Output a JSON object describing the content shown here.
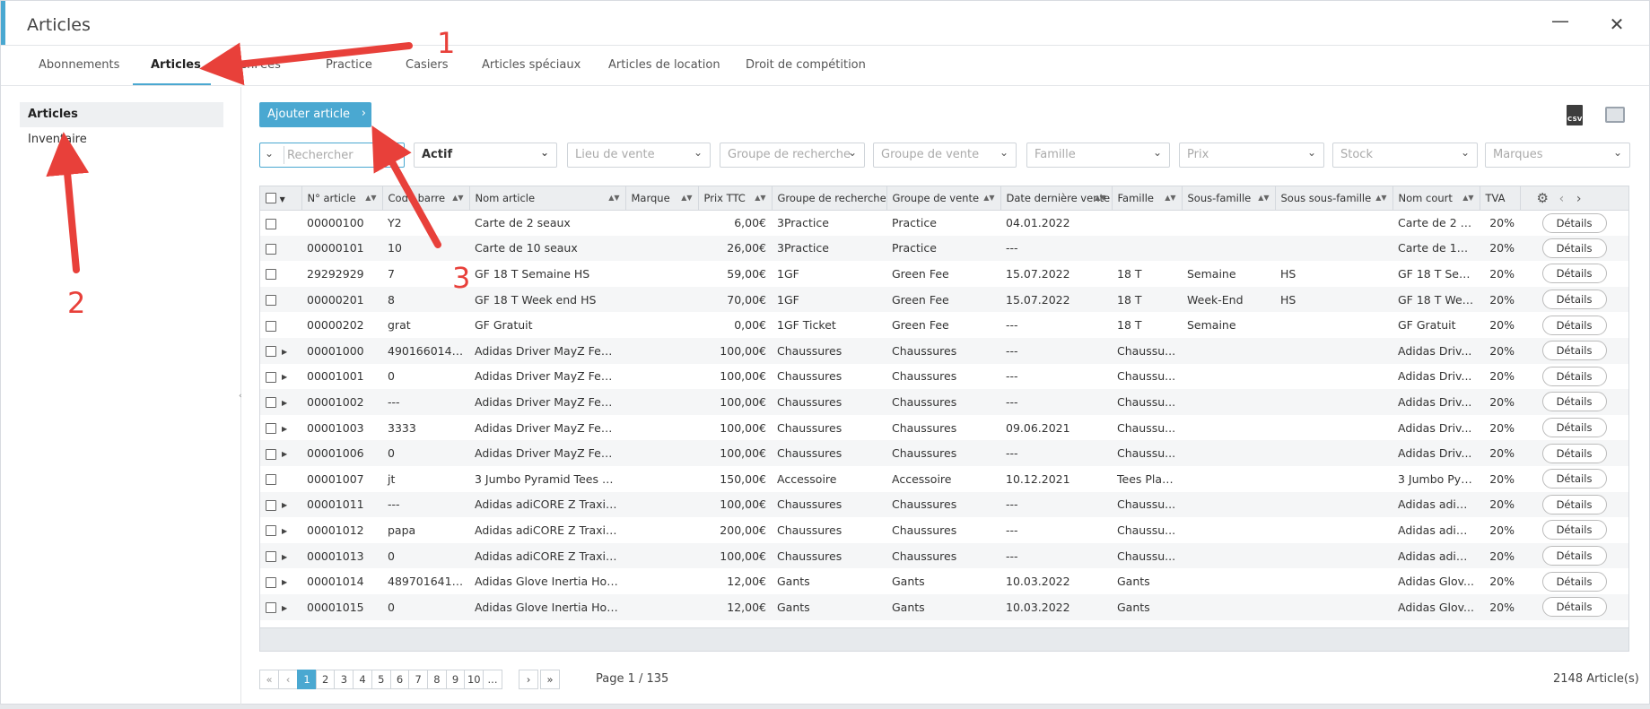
{
  "window": {
    "title": "Articles"
  },
  "tabs": [
    {
      "label": "Abonnements"
    },
    {
      "label": "Articles"
    },
    {
      "label": "GreenFees"
    },
    {
      "label": "Practice"
    },
    {
      "label": "Casiers"
    },
    {
      "label": "Articles spéciaux"
    },
    {
      "label": "Articles de location"
    },
    {
      "label": "Droit de compétition"
    }
  ],
  "sidebar": {
    "items": [
      {
        "label": "Articles"
      },
      {
        "label": "Inventaire"
      }
    ]
  },
  "toolbar": {
    "add_label": "Ajouter article",
    "csv_label": "CSV"
  },
  "filters": {
    "search_placeholder": "Rechercher",
    "status": "Actif",
    "lieu": "Lieu de vente",
    "groupe_recherche": "Groupe de recherche",
    "groupe_vente": "Groupe de vente",
    "famille": "Famille",
    "prix": "Prix",
    "stock": "Stock",
    "marques": "Marques"
  },
  "table": {
    "headers": [
      "N° article",
      "Code barre",
      "Nom article",
      "Marque",
      "Prix TTC",
      "Groupe de recherche",
      "Groupe de vente",
      "Date dernière vente",
      "Famille",
      "Sous-famille",
      "Sous sous-famille",
      "Nom court",
      "TVA"
    ],
    "details_label": "Détails",
    "rows": [
      {
        "expand": false,
        "num": "00000100",
        "code": "Y2",
        "nom": "Carte de 2 seaux",
        "marque": "",
        "prix": "6,00€",
        "grp_rech": "3Practice",
        "grp_vente": "Practice",
        "date": "04.01.2022",
        "famille": "",
        "sous": "",
        "soussous": "",
        "court": "Carte de 2 s...",
        "tva": "20%"
      },
      {
        "expand": false,
        "num": "00000101",
        "code": "10",
        "nom": "Carte de 10 seaux",
        "marque": "",
        "prix": "26,00€",
        "grp_rech": "3Practice",
        "grp_vente": "Practice",
        "date": "---",
        "famille": "",
        "sous": "",
        "soussous": "",
        "court": "Carte de 10 ...",
        "tva": "20%"
      },
      {
        "expand": false,
        "num": "29292929",
        "code": "7",
        "nom": "GF 18 T Semaine HS",
        "marque": "",
        "prix": "59,00€",
        "grp_rech": "1GF",
        "grp_vente": "Green Fee",
        "date": "15.07.2022",
        "famille": "18 T",
        "sous": "Semaine",
        "soussous": "HS",
        "court": "GF 18 T Sem...",
        "tva": "20%"
      },
      {
        "expand": false,
        "num": "00000201",
        "code": "8",
        "nom": "GF 18 T Week end HS",
        "marque": "",
        "prix": "70,00€",
        "grp_rech": "1GF",
        "grp_vente": "Green Fee",
        "date": "15.07.2022",
        "famille": "18 T",
        "sous": "Week-End",
        "soussous": "HS",
        "court": "GF 18 T Wee...",
        "tva": "20%"
      },
      {
        "expand": false,
        "num": "00000202",
        "code": "grat",
        "nom": "GF Gratuit",
        "marque": "",
        "prix": "0,00€",
        "grp_rech": "1GF Ticket",
        "grp_vente": "Green Fee",
        "date": "---",
        "famille": "18 T",
        "sous": "Semaine",
        "soussous": "",
        "court": "GF Gratuit",
        "tva": "20%"
      },
      {
        "expand": true,
        "num": "00001000",
        "code": "4901660143...",
        "nom": "Adidas Driver MayZ Fem...",
        "marque": "",
        "prix": "100,00€",
        "grp_rech": "Chaussures",
        "grp_vente": "Chaussures",
        "date": "---",
        "famille": "Chaussu...",
        "sous": "",
        "soussous": "",
        "court": "Adidas Driv...",
        "tva": "20%"
      },
      {
        "expand": true,
        "num": "00001001",
        "code": "0",
        "nom": "Adidas Driver MayZ Fem...",
        "marque": "",
        "prix": "100,00€",
        "grp_rech": "Chaussures",
        "grp_vente": "Chaussures",
        "date": "---",
        "famille": "Chaussu...",
        "sous": "",
        "soussous": "",
        "court": "Adidas Driv...",
        "tva": "20%"
      },
      {
        "expand": true,
        "num": "00001002",
        "code": "---",
        "nom": "Adidas Driver MayZ Fem...",
        "marque": "",
        "prix": "100,00€",
        "grp_rech": "Chaussures",
        "grp_vente": "Chaussures",
        "date": "---",
        "famille": "Chaussu...",
        "sous": "",
        "soussous": "",
        "court": "Adidas Driv...",
        "tva": "20%"
      },
      {
        "expand": true,
        "num": "00001003",
        "code": "3333",
        "nom": "Adidas Driver MayZ Fem...",
        "marque": "",
        "prix": "100,00€",
        "grp_rech": "Chaussures",
        "grp_vente": "Chaussures",
        "date": "09.06.2021",
        "famille": "Chaussu...",
        "sous": "",
        "soussous": "",
        "court": "Adidas Driv...",
        "tva": "20%"
      },
      {
        "expand": true,
        "num": "00001006",
        "code": "0",
        "nom": "Adidas Driver MayZ Fem...",
        "marque": "",
        "prix": "100,00€",
        "grp_rech": "Chaussures",
        "grp_vente": "Chaussures",
        "date": "---",
        "famille": "Chaussu...",
        "sous": "",
        "soussous": "",
        "court": "Adidas Driv...",
        "tva": "20%"
      },
      {
        "expand": false,
        "num": "00001007",
        "code": "jt",
        "nom": "3 Jumbo Pyramid Tees Ma...",
        "marque": "",
        "prix": "150,00€",
        "grp_rech": "Accessoire",
        "grp_vente": "Accessoire",
        "date": "10.12.2021",
        "famille": "Tees Plas...",
        "sous": "",
        "soussous": "",
        "court": "3 Jumbo Pyr...",
        "tva": "20%"
      },
      {
        "expand": true,
        "num": "00001011",
        "code": "---",
        "nom": "Adidas adiCORE Z Traxion...",
        "marque": "",
        "prix": "100,00€",
        "grp_rech": "Chaussures",
        "grp_vente": "Chaussures",
        "date": "---",
        "famille": "Chaussu...",
        "sous": "",
        "soussous": "",
        "court": "Adidas adiC...",
        "tva": "20%"
      },
      {
        "expand": true,
        "num": "00001012",
        "code": "papa",
        "nom": "Adidas adiCORE Z Traxion...",
        "marque": "",
        "prix": "200,00€",
        "grp_rech": "Chaussures",
        "grp_vente": "Chaussures",
        "date": "---",
        "famille": "Chaussu...",
        "sous": "",
        "soussous": "",
        "court": "Adidas adiC...",
        "tva": "20%"
      },
      {
        "expand": true,
        "num": "00001013",
        "code": "0",
        "nom": "Adidas adiCORE Z Traxion...",
        "marque": "",
        "prix": "100,00€",
        "grp_rech": "Chaussures",
        "grp_vente": "Chaussures",
        "date": "---",
        "famille": "Chaussu...",
        "sous": "",
        "soussous": "",
        "court": "Adidas adiC...",
        "tva": "20%"
      },
      {
        "expand": true,
        "num": "00001014",
        "code": "4897016415...",
        "nom": "Adidas Glove Inertia Hom...",
        "marque": "",
        "prix": "12,00€",
        "grp_rech": "Gants",
        "grp_vente": "Gants",
        "date": "10.03.2022",
        "famille": "Gants",
        "sous": "",
        "soussous": "",
        "court": "Adidas Glov...",
        "tva": "20%"
      },
      {
        "expand": true,
        "num": "00001015",
        "code": "0",
        "nom": "Adidas Glove Inertia Hom...",
        "marque": "",
        "prix": "12,00€",
        "grp_rech": "Gants",
        "grp_vente": "Gants",
        "date": "10.03.2022",
        "famille": "Gants",
        "sous": "",
        "soussous": "",
        "court": "Adidas Glov...",
        "tva": "20%"
      }
    ]
  },
  "pagination": {
    "first": "«",
    "prev": "‹",
    "next": "›",
    "last": "»",
    "pages": [
      "1",
      "2",
      "3",
      "4",
      "5",
      "6",
      "7",
      "8",
      "9",
      "10",
      "..."
    ],
    "current": "1",
    "info": "Page 1 / 135",
    "total": "2148 Article(s)"
  },
  "annotations": [
    "1",
    "2",
    "3"
  ],
  "colors": {
    "accent": "#4aa8d1",
    "annotation": "#e8403a"
  }
}
